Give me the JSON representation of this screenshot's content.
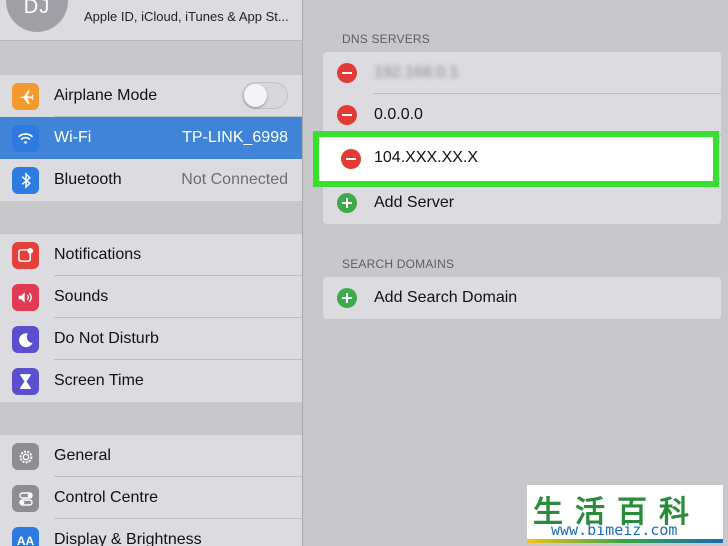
{
  "profile": {
    "initials": "DJ",
    "subtitle": "Apple ID, iCloud, iTunes & App St..."
  },
  "sidebar": {
    "group1": [
      {
        "label": "Airplane Mode",
        "icon": "airplane-icon",
        "color": "#f29a2e",
        "toggle": false
      },
      {
        "label": "Wi-Fi",
        "value": "TP-LINK_6998",
        "icon": "wifi-icon",
        "color": "#2d7be0",
        "selected": true
      },
      {
        "label": "Bluetooth",
        "value": "Not Connected",
        "icon": "bluetooth-icon",
        "color": "#2d7be0"
      }
    ],
    "group2": [
      {
        "label": "Notifications",
        "icon": "notifications-icon",
        "color": "#e5403a"
      },
      {
        "label": "Sounds",
        "icon": "sounds-icon",
        "color": "#e23a55"
      },
      {
        "label": "Do Not Disturb",
        "icon": "moon-icon",
        "color": "#5b4fcf"
      },
      {
        "label": "Screen Time",
        "icon": "hourglass-icon",
        "color": "#5b4fcf"
      }
    ],
    "group3": [
      {
        "label": "General",
        "icon": "gear-icon",
        "color": "#8e8d93"
      },
      {
        "label": "Control Centre",
        "icon": "switches-icon",
        "color": "#8e8d93"
      },
      {
        "label": "Display & Brightness",
        "icon": "display-icon",
        "color": "#2d7be0"
      }
    ]
  },
  "dns": {
    "header": "DNS SERVERS",
    "servers": [
      "192.168.0.1",
      "0.0.0.0",
      "104.XXX.XX.X"
    ],
    "add_label": "Add Server"
  },
  "search_domains": {
    "header": "SEARCH DOMAINS",
    "add_label": "Add Search Domain"
  },
  "watermark": {
    "chars": "生活百科",
    "url": "www.bimeiz.com"
  }
}
